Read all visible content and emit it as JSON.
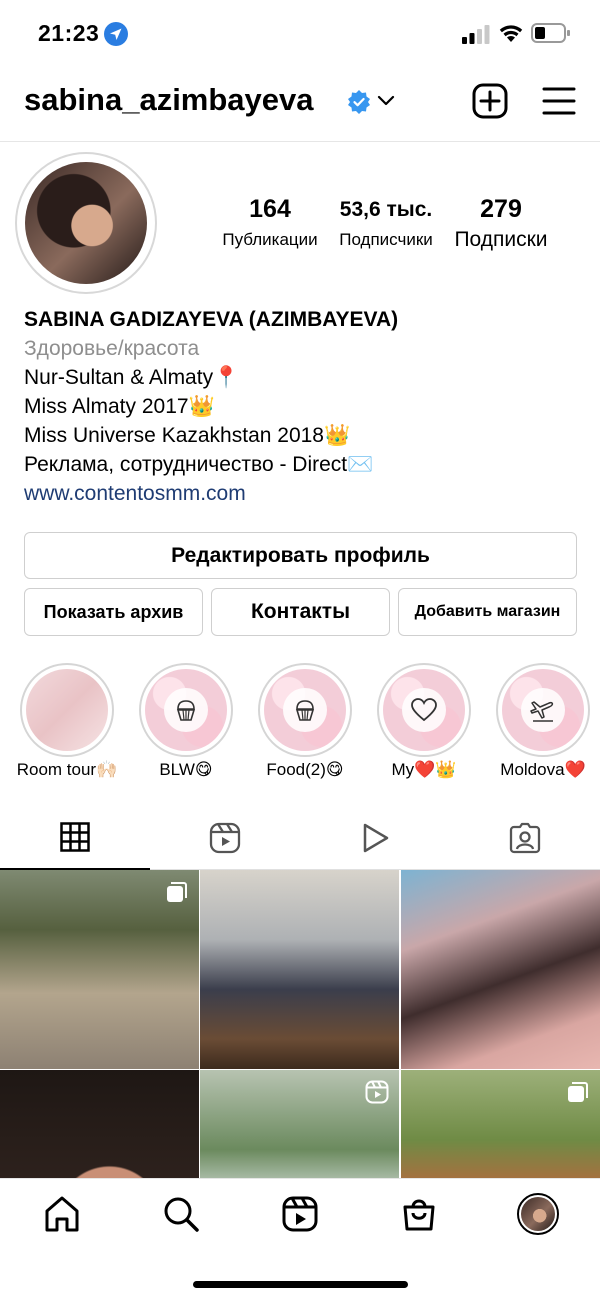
{
  "status_bar": {
    "time": "21:23"
  },
  "header": {
    "username": "sabina_azimbayeva"
  },
  "stats": [
    {
      "value": "164",
      "label": "Публикации"
    },
    {
      "value": "53,6 тыс.",
      "label": "Подписчики"
    },
    {
      "value": "279",
      "label": "Подписки"
    }
  ],
  "bio": {
    "name": "SABINA GADIZAYEVA (AZIMBAYEVA)",
    "category": "Здоровье/красота",
    "lines": [
      "Nur-Sultan & Almaty📍",
      "Miss Almaty 2017👑",
      "Miss Universe Kazakhstan 2018👑",
      "Реклама, сотрудничество - Direct✉️"
    ],
    "link": "www.contentosmm.com"
  },
  "buttons": {
    "edit_profile": "Редактировать профиль",
    "show_archive": "Показать архив",
    "contacts": "Контакты",
    "add_shop": "Добавить магазин"
  },
  "highlights": [
    {
      "label": "Room tour🙌🏻",
      "icon": "none"
    },
    {
      "label": "BLW😋",
      "icon": "cupcake-icon"
    },
    {
      "label": "Food(2)😋",
      "icon": "cupcake-icon"
    },
    {
      "label": "My❤️👑",
      "icon": "heart-icon"
    },
    {
      "label": "Moldova❤️",
      "icon": "airplane-icon"
    }
  ],
  "tabs": [
    "grid-icon",
    "reels-icon",
    "video-icon",
    "tagged-icon"
  ],
  "colors": {
    "verified": "#3897f0",
    "link": "#1f3c73",
    "secondary_text": "#8e8e8e"
  }
}
